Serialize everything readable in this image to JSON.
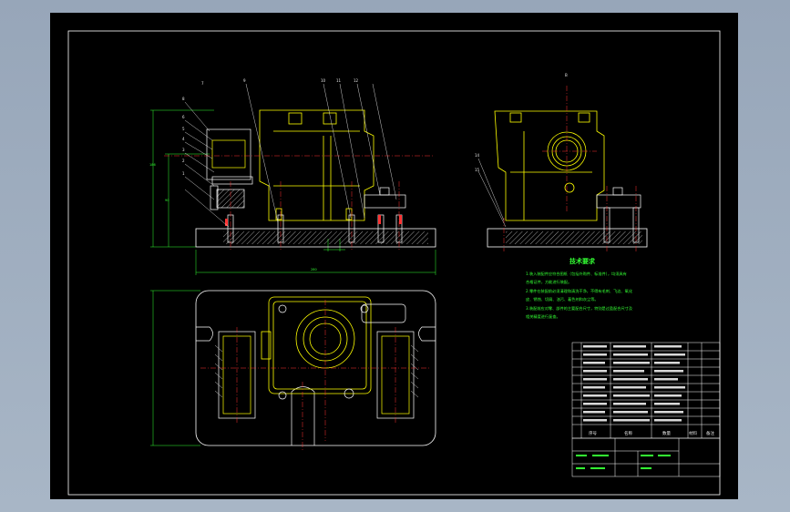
{
  "drawing": {
    "view_label": "B",
    "tech_requirements_title": "技术要求",
    "tech_notes": [
      "1.装入装配件应符合图纸（包括外购件、标准件），均须具有",
      "合格证件，方能进行装配。",
      "2.零件在装配前必须清理和清洗干净，不得有毛刺、飞边、氧化",
      "皮、锈蚀、切屑、油污、着色剂和灰尘等。",
      "3.装配前应对零、部件的主要配合尺寸，特别是过盈配合尺寸及",
      "相关精度进行复查。"
    ],
    "front_balloons": [
      "8",
      "7",
      "6",
      "5",
      "4",
      "3",
      "2",
      "1",
      "9",
      "10",
      "11",
      "12"
    ],
    "side_balloons": [
      "14",
      "15"
    ],
    "bom_headers": {
      "seq": "序号",
      "name": "名称",
      "qty": "数量",
      "material": "材料",
      "remark": "备注"
    },
    "colors": {
      "background": "#000000",
      "outline": "#ffffff",
      "part": "#ffff00",
      "center": "#ff3333",
      "dimension": "#33ff33",
      "hidden": "#ff66ff"
    }
  }
}
